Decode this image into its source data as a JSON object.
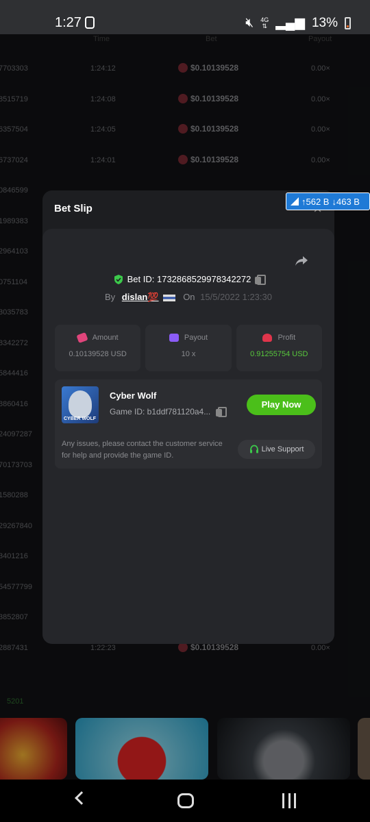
{
  "status": {
    "time": "1:27",
    "network": "4G",
    "battery": "13%"
  },
  "table": {
    "headers": {
      "time": "Time",
      "bet": "Bet",
      "payout": "Payout"
    },
    "rows": [
      {
        "id": "7703303",
        "time": "1:24:12",
        "bet": "$0.10139528",
        "payout": "0.00×"
      },
      {
        "id": "8515719",
        "time": "1:24:08",
        "bet": "$0.10139528",
        "payout": "0.00×"
      },
      {
        "id": "6357504",
        "time": "1:24:05",
        "bet": "$0.10139528",
        "payout": "0.00×"
      },
      {
        "id": "6737024",
        "time": "1:24:01",
        "bet": "$0.10139528",
        "payout": "0.00×"
      },
      {
        "id": "0846599",
        "time": "",
        "bet": "",
        "payout": ""
      },
      {
        "id": "1989383",
        "time": "",
        "bet": "",
        "payout": ""
      },
      {
        "id": "2964103",
        "time": "",
        "bet": "",
        "payout": ""
      },
      {
        "id": "0751104",
        "time": "",
        "bet": "",
        "payout": ""
      },
      {
        "id": "3035783",
        "time": "",
        "bet": "",
        "payout": ""
      },
      {
        "id": "8342272",
        "time": "",
        "bet": "",
        "payout": ""
      },
      {
        "id": "5844416",
        "time": "",
        "bet": "",
        "payout": ""
      },
      {
        "id": "8860416",
        "time": "",
        "bet": "",
        "payout": ""
      },
      {
        "id": "24097287",
        "time": "",
        "bet": "",
        "payout": ""
      },
      {
        "id": "70173703",
        "time": "",
        "bet": "",
        "payout": ""
      },
      {
        "id": "1580288",
        "time": "",
        "bet": "",
        "payout": ""
      },
      {
        "id": "29267840",
        "time": "",
        "bet": "",
        "payout": ""
      },
      {
        "id": "3401216",
        "time": "",
        "bet": "",
        "payout": ""
      },
      {
        "id": "54577799",
        "time": "",
        "bet": "",
        "payout": ""
      },
      {
        "id": "3852807",
        "time": "",
        "bet": "",
        "payout": ""
      },
      {
        "id": "2887431",
        "time": "1:22:23",
        "bet": "$0.10139528",
        "payout": "0.00×"
      }
    ],
    "count": "5201"
  },
  "speed": {
    "up": "↑562 B",
    "down": "↓463 B"
  },
  "modal": {
    "title": "Bet Slip",
    "close": "×",
    "bet_id_label": "Bet ID: 1732868529978342272",
    "by_label": "By",
    "user": "dislan💯",
    "on_label": "On",
    "date": "15/5/2022 1:23:30",
    "stats": [
      {
        "label": "Amount",
        "value": "0.10139528 USD",
        "color": "#e0457b"
      },
      {
        "label": "Payout",
        "value": "10 x",
        "color": "#8b5cf6"
      },
      {
        "label": "Profit",
        "value": "0.91255754 USD",
        "color": "#e0354b"
      }
    ],
    "game": {
      "name": "Cyber Wolf",
      "thumb_text": "CYBER WOLF",
      "id_label": "Game ID: b1ddf781120a4...",
      "play_label": "Play Now",
      "issues_text": "Any issues, please contact the customer service for help and provide the game ID.",
      "support_label": "Live Support"
    }
  },
  "colors": {
    "accent_green": "#4bbf1a",
    "profit_green": "#58c83c",
    "speed_blue": "#1f7ad6"
  }
}
